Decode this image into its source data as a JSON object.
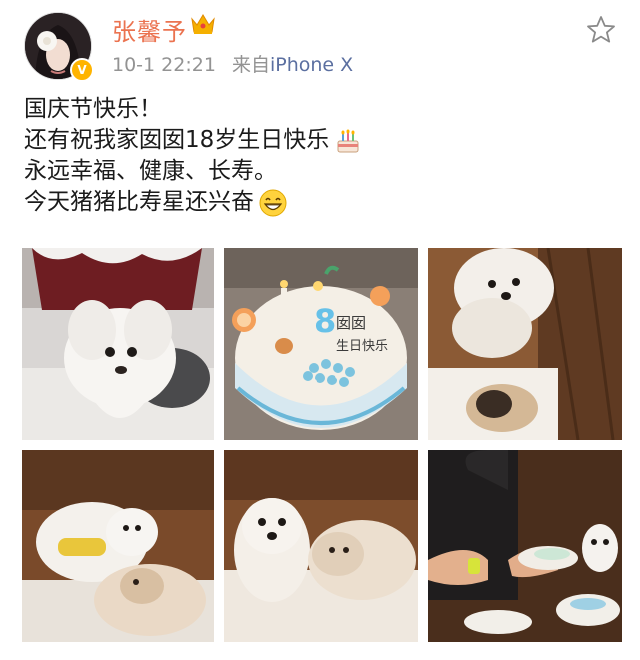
{
  "user": {
    "name": "张馨予",
    "badge_icon": "crown-icon",
    "verified_icon": "verified-badge-icon",
    "name_color": "#eb7350"
  },
  "post": {
    "time": "10-1 22:21",
    "source_label": "来自",
    "source_device": "iPhone X",
    "lines": [
      "国庆节快乐！",
      "还有祝我家囡囡18岁生日快乐",
      "永远幸福、健康、长寿。",
      "今天猪猪比寿星还兴奋"
    ],
    "emojis": [
      "cake-emoji",
      "grin-emoji"
    ]
  },
  "cake_text": {
    "number": "8",
    "line1": "囡囡",
    "line2": "生日快乐"
  },
  "photos": [
    "dog-with-party-hat",
    "birthday-cake",
    "pomeranian-on-floor",
    "dogs-on-blanket",
    "two-dogs-sitting",
    "person-cutting-cake"
  ],
  "actions": {
    "favorite_icon": "star-icon"
  }
}
